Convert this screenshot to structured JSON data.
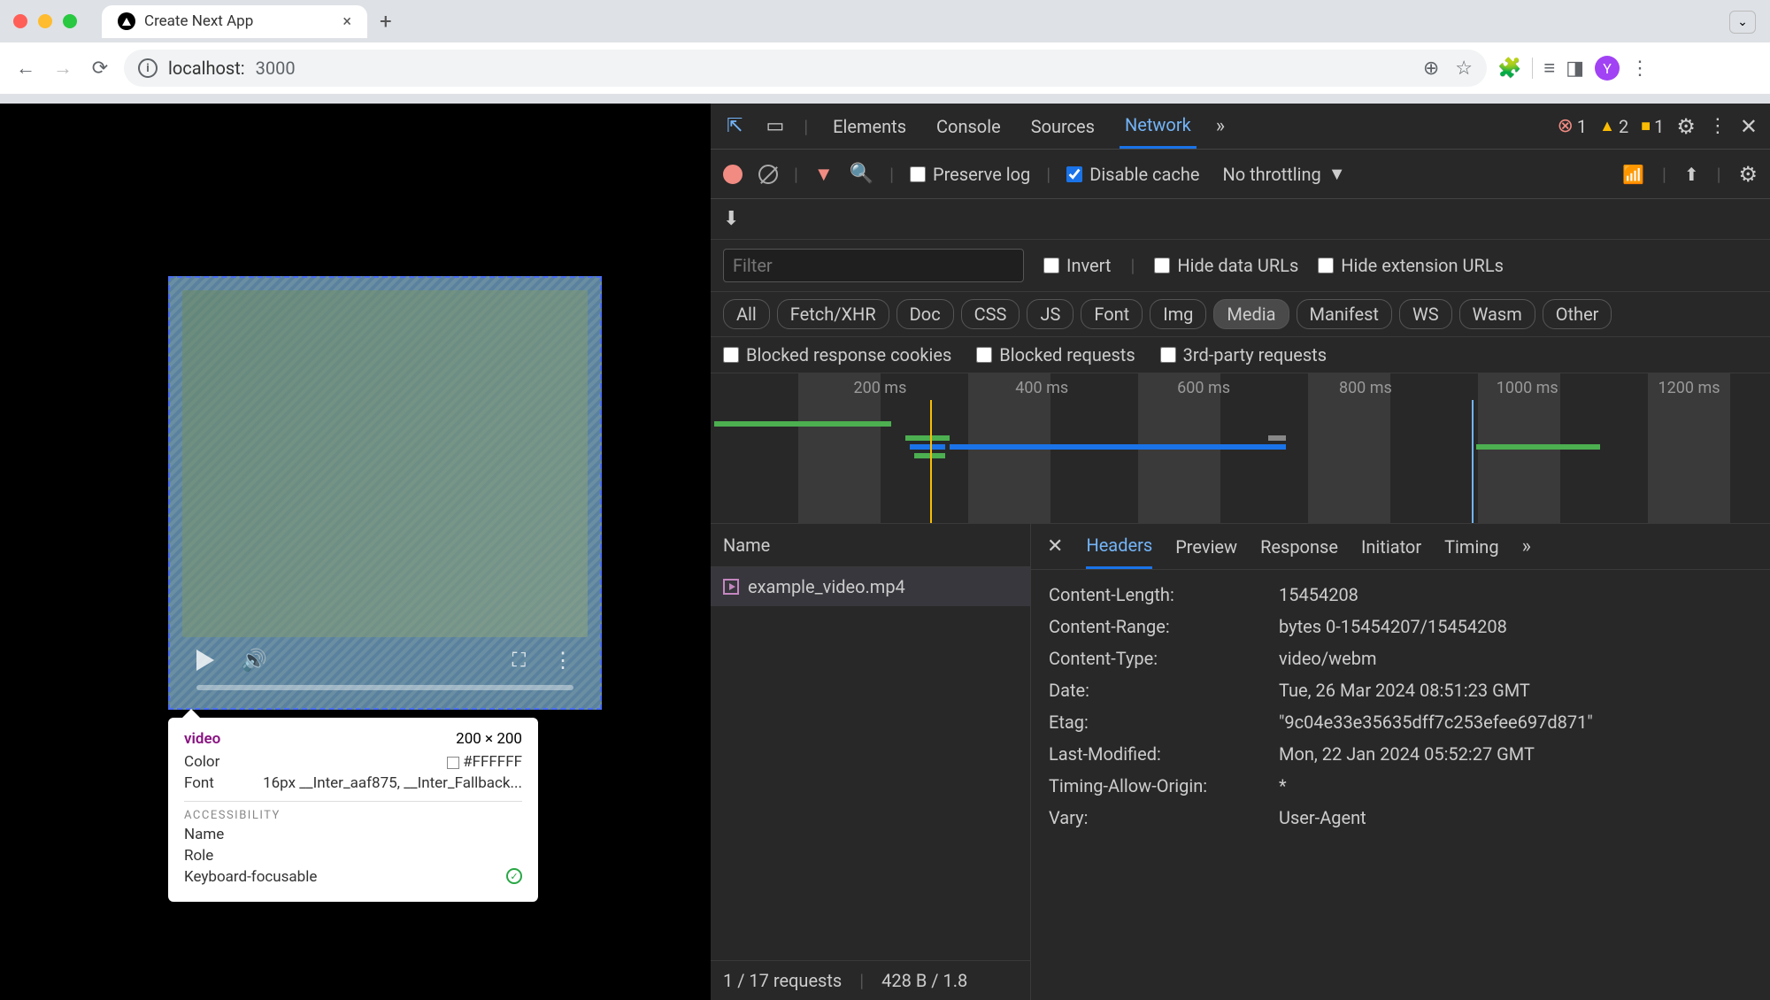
{
  "browser": {
    "tab_title": "Create Next App",
    "new_tab": "+",
    "address": "localhost:3000",
    "address_host": "localhost:",
    "address_port": "3000",
    "avatar_letter": "Y"
  },
  "page": {
    "inspect": {
      "tag": "video",
      "dims": "200 × 200",
      "color_label": "Color",
      "color_value": "#FFFFFF",
      "font_label": "Font",
      "font_value": "16px __Inter_aaf875, __Inter_Fallback...",
      "section": "ACCESSIBILITY",
      "acc_name": "Name",
      "acc_role": "Role",
      "acc_kf": "Keyboard-focusable"
    }
  },
  "devtools": {
    "tabs": [
      "Elements",
      "Console",
      "Sources",
      "Network"
    ],
    "active_tab": "Network",
    "more_tabs": "»",
    "errors": "1",
    "warnings": "2",
    "issues": "1",
    "toolbar": {
      "preserve_log": "Preserve log",
      "preserve_checked": false,
      "disable_cache": "Disable cache",
      "disable_checked": true,
      "throttling": "No throttling"
    },
    "filter": {
      "placeholder": "Filter",
      "invert": "Invert",
      "hide_data": "Hide data URLs",
      "hide_ext": "Hide extension URLs"
    },
    "types": [
      "All",
      "Fetch/XHR",
      "Doc",
      "CSS",
      "JS",
      "Font",
      "Img",
      "Media",
      "Manifest",
      "WS",
      "Wasm",
      "Other"
    ],
    "active_type": "Media",
    "block": {
      "cookies": "Blocked response cookies",
      "requests": "Blocked requests",
      "thirdparty": "3rd-party requests"
    },
    "timeline_labels": [
      "200 ms",
      "400 ms",
      "600 ms",
      "800 ms",
      "1000 ms",
      "1200 ms"
    ],
    "name_header": "Name",
    "requests": [
      "example_video.mp4"
    ],
    "detail_tabs": [
      "Headers",
      "Preview",
      "Response",
      "Initiator",
      "Timing"
    ],
    "detail_active": "Headers",
    "detail_more": "»",
    "headers": [
      {
        "k": "Content-Length:",
        "v": "15454208"
      },
      {
        "k": "Content-Range:",
        "v": "bytes 0-15454207/15454208"
      },
      {
        "k": "Content-Type:",
        "v": "video/webm"
      },
      {
        "k": "Date:",
        "v": "Tue, 26 Mar 2024 08:51:23 GMT"
      },
      {
        "k": "Etag:",
        "v": "\"9c04e33e35635dff7c253efee697d871\""
      },
      {
        "k": "Last-Modified:",
        "v": "Mon, 22 Jan 2024 05:52:27 GMT"
      },
      {
        "k": "Timing-Allow-Origin:",
        "v": "*"
      },
      {
        "k": "Vary:",
        "v": "User-Agent"
      }
    ],
    "status": {
      "req": "1 / 17 requests",
      "size": "428 B / 1.8"
    }
  }
}
